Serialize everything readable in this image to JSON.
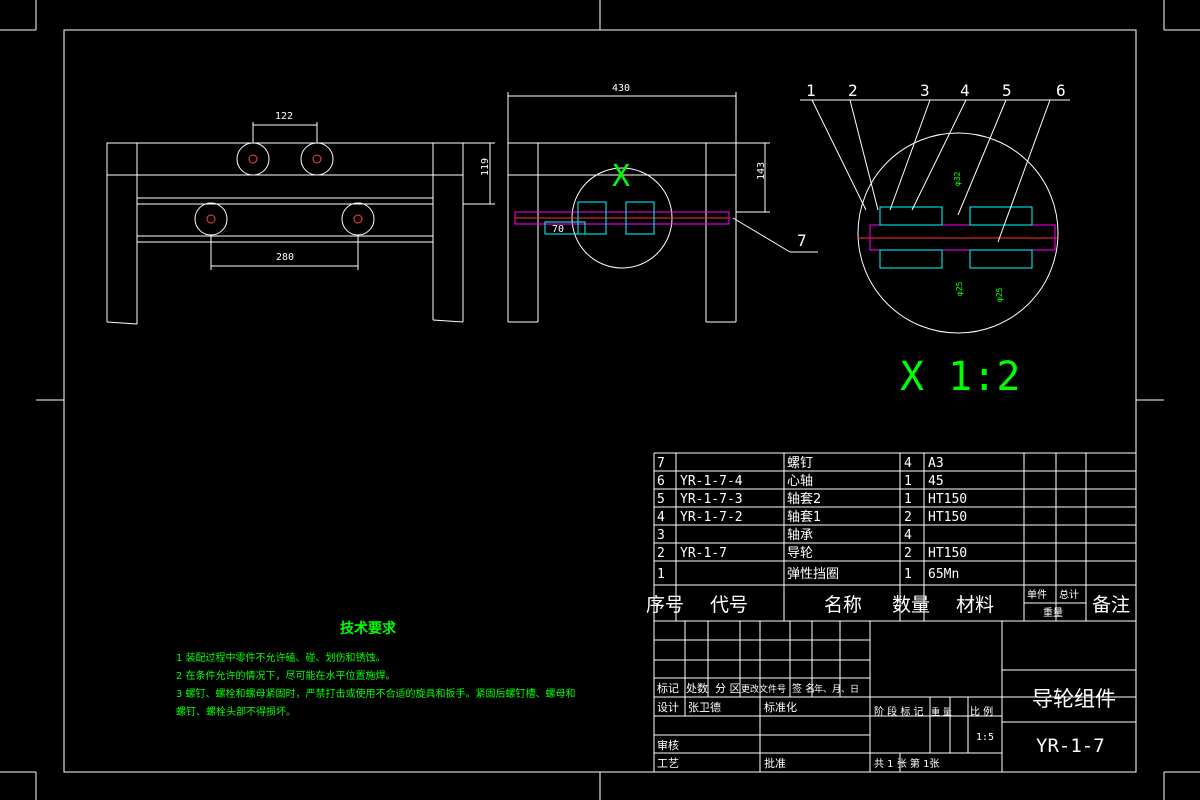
{
  "dimensions": {
    "top_width": "122",
    "bottom_width": "280",
    "side_height": "119",
    "overall_width": "430",
    "height_right": "143",
    "shaft_width": "70",
    "detail_dim_1": "φ32",
    "detail_dim_2": "φ25",
    "detail_dim_3": "φ25"
  },
  "views": {
    "detail_marker": "X",
    "detail_label": "X 1:2",
    "balloons": [
      "1",
      "2",
      "3",
      "4",
      "5",
      "6",
      "7"
    ]
  },
  "technical_requirements": {
    "title": "技术要求",
    "items": [
      "1  装配过程中零件不允许磕、碰、划伤和锈蚀。",
      "2  在条件允许的情况下，尽可能在水平位置施焊。",
      "3  螺钉、螺栓和螺母紧固时，严禁打击或使用不合适的旋具和扳手。紧固后螺钉槽、螺母和",
      "   螺钉、螺栓头部不得损坏。"
    ]
  },
  "bom": {
    "rows": [
      {
        "no": "7",
        "code": "",
        "name": "螺钉",
        "qty": "4",
        "material": "A3"
      },
      {
        "no": "6",
        "code": "YR-1-7-4",
        "name": "心轴",
        "qty": "1",
        "material": "45"
      },
      {
        "no": "5",
        "code": "YR-1-7-3",
        "name": "轴套2",
        "qty": "1",
        "material": "HT150"
      },
      {
        "no": "4",
        "code": "YR-1-7-2",
        "name": "轴套1",
        "qty": "2",
        "material": "HT150"
      },
      {
        "no": "3",
        "code": "",
        "name": "轴承",
        "qty": "4",
        "material": ""
      },
      {
        "no": "2",
        "code": "YR-1-7",
        "name": "导轮",
        "qty": "2",
        "material": "HT150"
      },
      {
        "no": "1",
        "code": "",
        "name": "弹性挡圈",
        "qty": "1",
        "material": "65Mn"
      }
    ],
    "headers": {
      "no": "序号",
      "code": "代号",
      "name": "名称",
      "qty": "数量",
      "material": "材料",
      "unit": "单件",
      "total": "总计",
      "weight": "重量",
      "remark": "备注"
    }
  },
  "title_block": {
    "mark": "标记",
    "count": "处数",
    "zone": "分 区",
    "doc": "更改文件号",
    "sign": "签 名",
    "date": "年、月、日",
    "design": "设计",
    "designer": "张卫德",
    "standard": "标准化",
    "stage": "阶 段 标 记",
    "weight": "重 量",
    "scale": "比 例",
    "scale_value": "1:5",
    "check": "审核",
    "process": "工艺",
    "approve": "批准",
    "sheets": "共  1  张    第    1张",
    "title": "导轮组件",
    "code": "YR-1-7"
  }
}
